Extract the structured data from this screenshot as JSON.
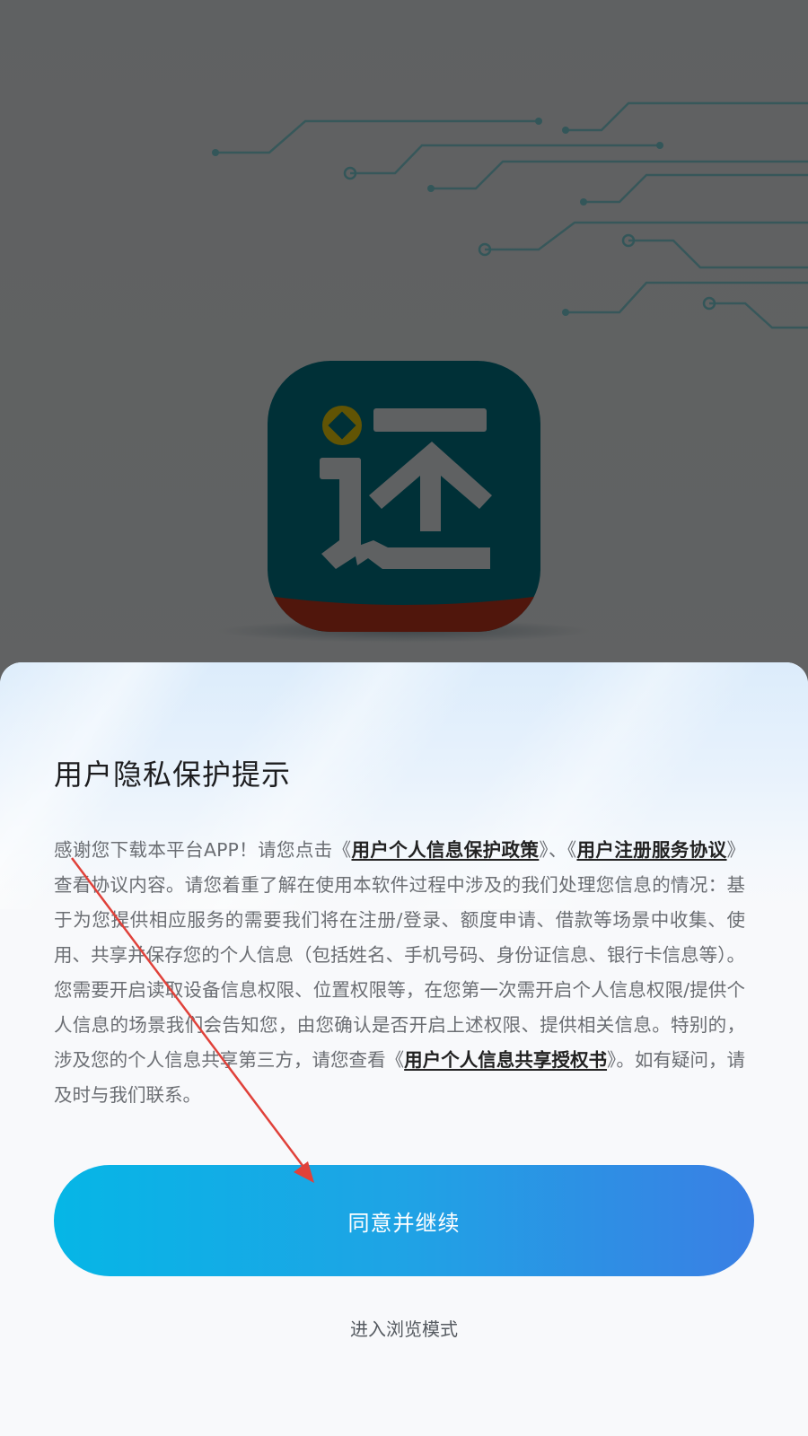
{
  "splash": {
    "app_icon": "huan-repay-app-icon",
    "app_icon_char": "还",
    "colors": {
      "icon_teal": "#00798a",
      "icon_red": "#c9371e",
      "icon_gold": "#f2d20c",
      "circuit": "#7fd8df"
    }
  },
  "privacy_sheet": {
    "title": "用户隐私保护提示",
    "body": {
      "t1": "感谢您下载本平台APP！请您点击《",
      "link_privacy_policy": "用户个人信息保护政策",
      "t2": "》、《",
      "link_registration_agreement": "用户注册服务协议",
      "t3": "》查看协议内容。请您着重了解在使用本软件过程中涉及的我们处理您信息的情况：基于为您提供相应服务的需要我们将在注册/登录、额度申请、借款等场景中收集、使用、共享并保存您的个人信息（包括姓名、手机号码、身份证信息、银行卡信息等）。您需要开启读取设备信息权限、位置权限等，在您第一次需开启个人信息权限/提供个人信息的场景我们会告知您，由您确认是否开启上述权限、提供相关信息。特别的，涉及您的个人信息共享第三方，请您查看《",
      "link_sharing_authorization": "用户个人信息共享授权书",
      "t4": "》。如有疑问，请及时与我们联系。"
    },
    "agree_button_label": "同意并继续",
    "browse_mode_label": "进入浏览模式",
    "colors": {
      "button_start": "#06b6e6",
      "button_end": "#3a7fe4",
      "annotation_arrow": "#e0413a"
    }
  }
}
